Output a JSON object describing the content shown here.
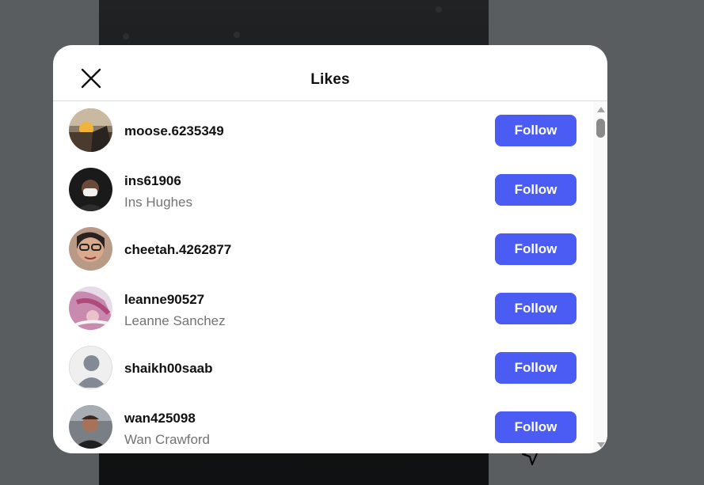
{
  "modal": {
    "title": "Likes",
    "close_icon": "close-icon"
  },
  "likes": [
    {
      "username": "moose.6235349",
      "fullname": "",
      "follow_label": "Follow",
      "avatar": "photo-sunset"
    },
    {
      "username": "ins61906",
      "fullname": "Ins Hughes",
      "follow_label": "Follow",
      "avatar": "photo-mask"
    },
    {
      "username": "cheetah.4262877",
      "fullname": "",
      "follow_label": "Follow",
      "avatar": "photo-glasses"
    },
    {
      "username": "leanne90527",
      "fullname": "Leanne Sanchez",
      "follow_label": "Follow",
      "avatar": "photo-pink"
    },
    {
      "username": "shaikh00saab",
      "fullname": "",
      "follow_label": "Follow",
      "avatar": "default-avatar-icon"
    },
    {
      "username": "wan425098",
      "fullname": "Wan Crawford",
      "follow_label": "Follow",
      "avatar": "photo-car"
    }
  ],
  "colors": {
    "follow_button": "#4a5cf4",
    "secondary_text": "#737373",
    "backdrop": "#5a5d60"
  }
}
